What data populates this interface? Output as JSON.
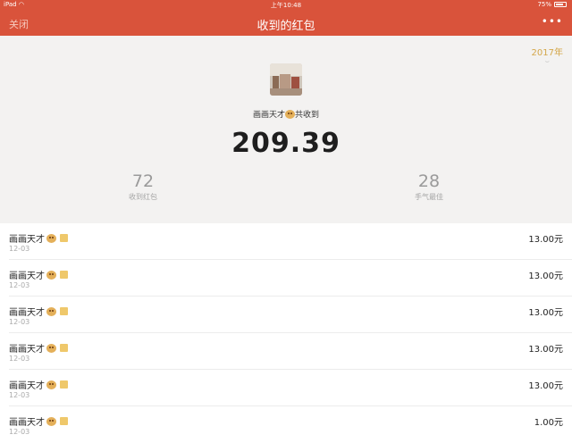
{
  "status_bar": {
    "device": "iPad",
    "time": "上午10:48",
    "battery": "75%"
  },
  "nav": {
    "close": "关闭",
    "title": "收到的红包",
    "more": "•••"
  },
  "summary": {
    "year": "2017年",
    "sender_name": "画画天才",
    "sender_suffix": "共收到",
    "total": "209.39",
    "stats": [
      {
        "value": "72",
        "label": "收到红包"
      },
      {
        "value": "28",
        "label": "手气最佳"
      }
    ]
  },
  "records": [
    {
      "name": "画画天才",
      "date": "12-03",
      "amount": "13.00元"
    },
    {
      "name": "画画天才",
      "date": "12-03",
      "amount": "13.00元"
    },
    {
      "name": "画画天才",
      "date": "12-03",
      "amount": "13.00元"
    },
    {
      "name": "画画天才",
      "date": "12-03",
      "amount": "13.00元"
    },
    {
      "name": "画画天才",
      "date": "12-03",
      "amount": "13.00元"
    },
    {
      "name": "画画天才",
      "date": "12-03",
      "amount": "1.00元"
    }
  ]
}
